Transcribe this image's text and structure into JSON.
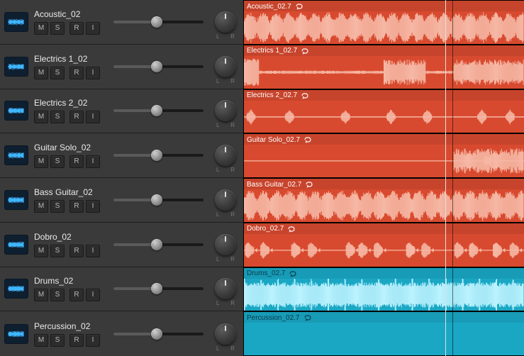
{
  "colors": {
    "red": "#d84a2f",
    "redHeader": "#c7442c",
    "cyan": "#1aa7c4",
    "cyanHeader": "#189bb6",
    "waveLight": "#f6b9a6",
    "waveCyanLight": "#bdf3ff",
    "playhead": "#e0e0e0"
  },
  "playhead_pct": 72,
  "region_split_pct": 74.5,
  "buttons": {
    "mute": "M",
    "solo": "S",
    "record": "R",
    "input": "I"
  },
  "knob": {
    "left_label": "L",
    "right_label": "R"
  },
  "tracks": [
    {
      "name": "Acoustic_02",
      "region_label": "Acoustic_02.7",
      "color": "red",
      "fader_pct": 48,
      "wave_density": "dense"
    },
    {
      "name": "Electrics 1_02",
      "region_label": "Electrics 1_02.7",
      "color": "red",
      "fader_pct": 48,
      "wave_density": "mixed1"
    },
    {
      "name": "Electrics 2_02",
      "region_label": "Electrics 2_02.7",
      "color": "red",
      "fader_pct": 48,
      "wave_density": "sparse_blips"
    },
    {
      "name": "Guitar Solo_02",
      "region_label": "Guitar Solo_02.7",
      "color": "red",
      "fader_pct": 48,
      "wave_density": "solo"
    },
    {
      "name": "Bass Guitar_02",
      "region_label": "Bass Guitar_02.7",
      "color": "red",
      "fader_pct": 48,
      "wave_density": "dense"
    },
    {
      "name": "Dobro_02",
      "region_label": "Dobro_02.7",
      "color": "red",
      "fader_pct": 48,
      "wave_density": "dobro"
    },
    {
      "name": "Drums_02",
      "region_label": "Drums_02.7",
      "color": "cyan",
      "fader_pct": 48,
      "wave_density": "drums"
    },
    {
      "name": "Percussion_02",
      "region_label": "Percussion_02.7",
      "color": "cyan",
      "fader_pct": 48,
      "wave_density": "empty"
    }
  ]
}
